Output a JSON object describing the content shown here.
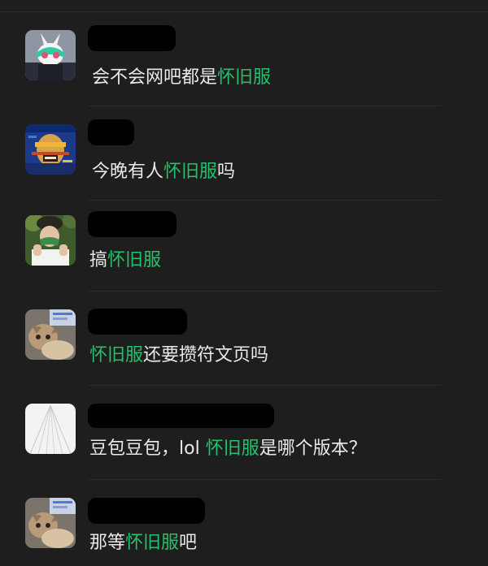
{
  "messages": [
    {
      "avatar": "cartoon-bunny-avatar",
      "pre": "会不会网吧都是",
      "hl": "怀旧服",
      "post": ""
    },
    {
      "avatar": "glitch-portrait-avatar",
      "pre": "今晚有人",
      "hl": "怀旧服",
      "post": "吗"
    },
    {
      "avatar": "person-photo-avatar",
      "pre": "搞",
      "hl": "怀旧服",
      "post": ""
    },
    {
      "avatar": "cat-photo-avatar",
      "pre": "",
      "hl": "怀旧服",
      "post": "还要攒符文页吗"
    },
    {
      "avatar": "white-lines-avatar",
      "pre": "豆包豆包，lol ",
      "hl": "怀旧服",
      "post": "是哪个版本？"
    },
    {
      "avatar": "cat-photo-avatar",
      "pre": "那等",
      "hl": "怀旧服",
      "post": "吧"
    }
  ],
  "colors": {
    "background": "#1e1e1f",
    "text": "#e9e9e9",
    "highlight": "#23c16b",
    "redaction": "#000000"
  }
}
